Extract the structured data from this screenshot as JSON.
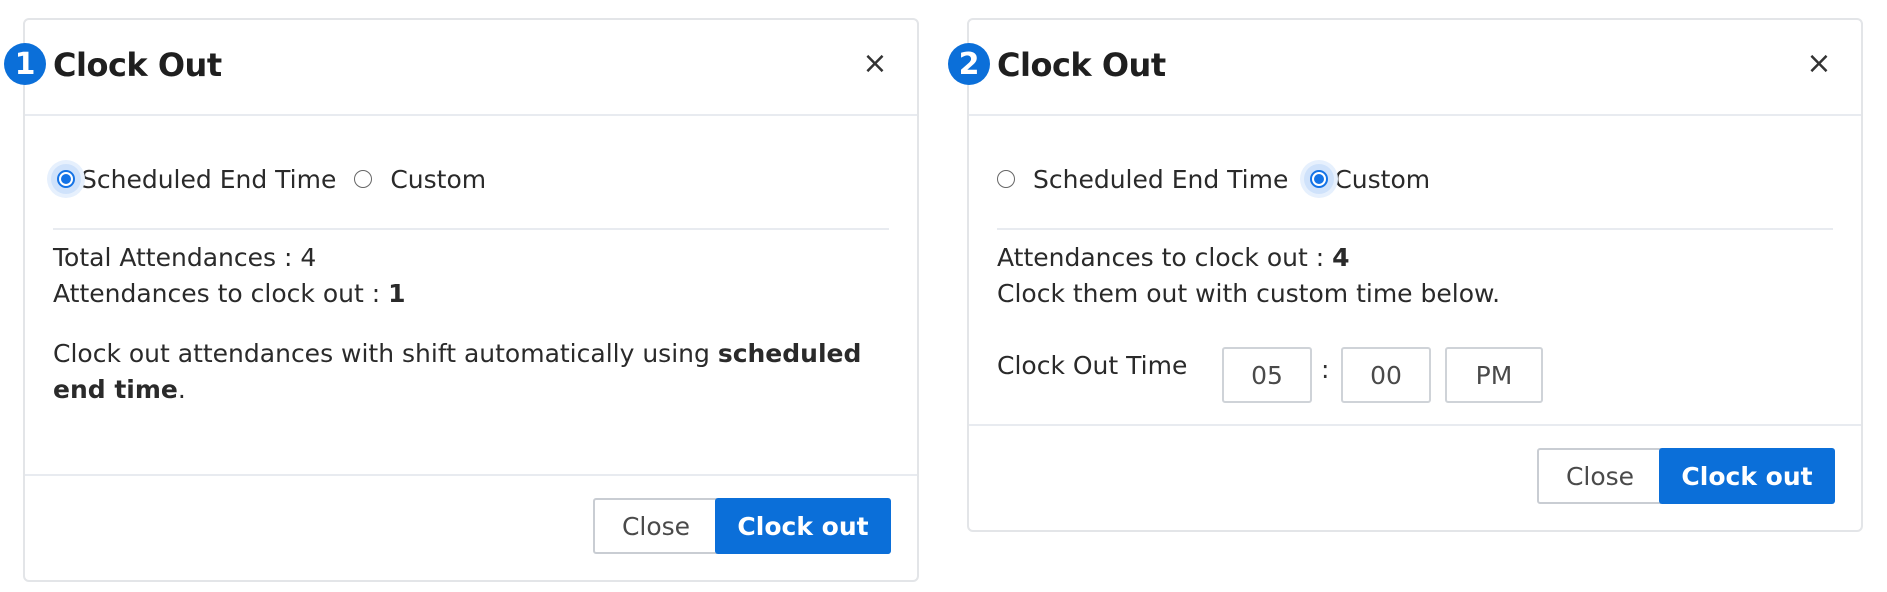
{
  "dialogs": [
    {
      "step": "1",
      "title": "Clock Out",
      "close_icon": "×",
      "radio_scheduled": "Scheduled End Time",
      "radio_custom": "Custom",
      "selected": "scheduled",
      "total_label": "Total Attendances : ",
      "total_value": "4",
      "to_clock_label": "Attendances to clock out : ",
      "to_clock_value": "1",
      "desc_pre": "Clock out attendances with shift automatically using ",
      "desc_bold": "scheduled end time",
      "desc_post": ".",
      "close_button": "Close",
      "primary_button": "Clock out"
    },
    {
      "step": "2",
      "title": "Clock Out",
      "close_icon": "×",
      "radio_scheduled": "Scheduled End Time",
      "radio_custom": "Custom",
      "selected": "custom",
      "to_clock_label": "Attendances to clock out : ",
      "to_clock_value": "4",
      "desc": "Clock them out with custom time below.",
      "time_label": "Clock Out Time",
      "hour": "05",
      "separator": ":",
      "minute": "00",
      "ampm": "PM",
      "close_button": "Close",
      "primary_button": "Clock out"
    }
  ],
  "colors": {
    "accent": "#0b6fd9",
    "border": "#e3e5e8"
  }
}
